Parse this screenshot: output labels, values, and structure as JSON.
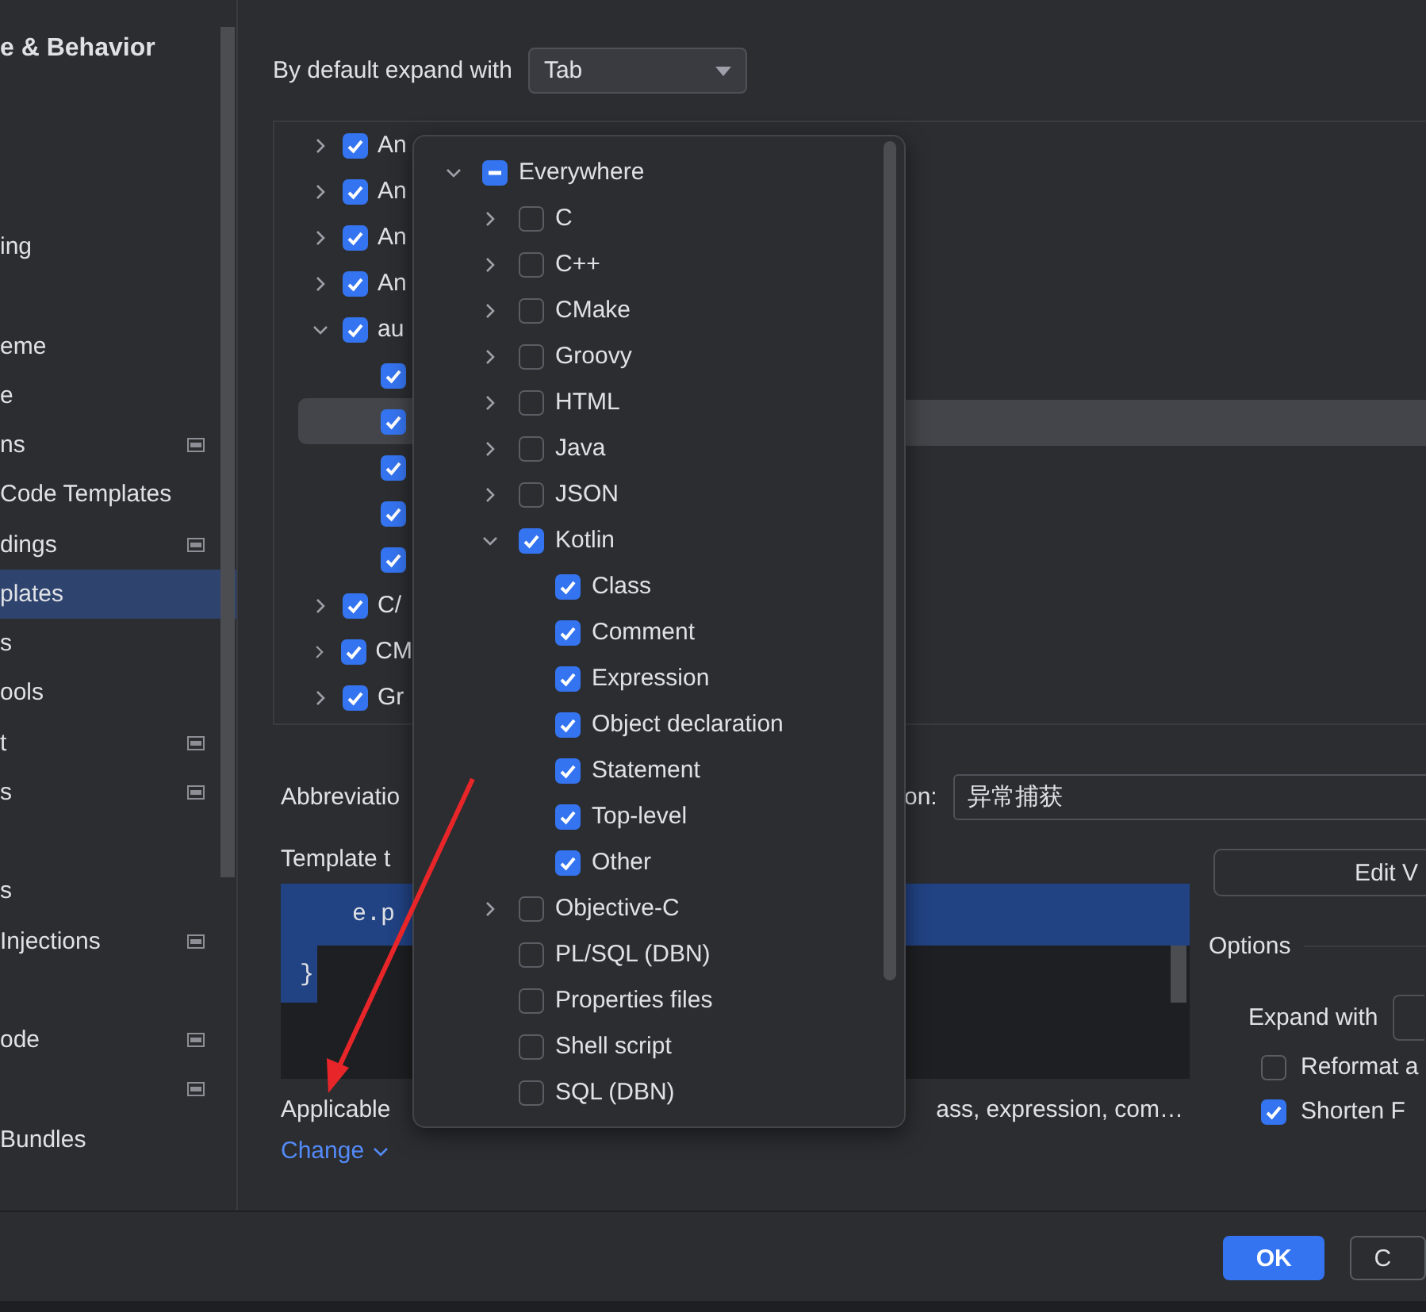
{
  "sidebar": {
    "items": [
      {
        "kind": "header",
        "text": "e & Behavior"
      },
      {
        "kind": "blank"
      },
      {
        "kind": "blank"
      },
      {
        "kind": "blank"
      },
      {
        "kind": "item",
        "text": "ing",
        "selected": false
      },
      {
        "kind": "blank"
      },
      {
        "kind": "item",
        "text": "eme",
        "selected": false
      },
      {
        "kind": "item",
        "text": "e",
        "selected": false
      },
      {
        "kind": "item",
        "text": "ns",
        "badge": true,
        "selected": false
      },
      {
        "kind": "item",
        "text": "Code Templates",
        "selected": false
      },
      {
        "kind": "item",
        "text": "dings",
        "badge": true,
        "selected": false
      },
      {
        "kind": "item",
        "text": "plates",
        "selected": true
      },
      {
        "kind": "item",
        "text": "s",
        "selected": false
      },
      {
        "kind": "item",
        "text": "ools",
        "selected": false
      },
      {
        "kind": "item",
        "text": "t",
        "badge": true,
        "selected": false
      },
      {
        "kind": "item",
        "text": "s",
        "badge": true,
        "selected": false
      },
      {
        "kind": "blank"
      },
      {
        "kind": "item",
        "text": "s",
        "selected": false
      },
      {
        "kind": "item",
        "text": " Injections",
        "badge": true,
        "selected": false
      },
      {
        "kind": "blank"
      },
      {
        "kind": "item",
        "text": "ode",
        "badge": true,
        "selected": false
      },
      {
        "kind": "item",
        "badge": true,
        "selected": false
      },
      {
        "kind": "item",
        "text": " Bundles",
        "selected": false
      }
    ]
  },
  "expand_default": {
    "label": "By default expand with",
    "value": "Tab"
  },
  "template_tree": [
    {
      "text": "An",
      "checked": true,
      "expanded": false,
      "selected": false
    },
    {
      "text": "An",
      "checked": true,
      "expanded": false,
      "selected": false
    },
    {
      "text": "An",
      "checked": true,
      "expanded": false,
      "selected": false
    },
    {
      "text": "An",
      "checked": true,
      "expanded": false,
      "selected": false
    },
    {
      "text": "au",
      "checked": true,
      "expanded": true,
      "selected": false,
      "children": [
        {
          "checked": true,
          "selected": false
        },
        {
          "checked": true,
          "selected": true
        },
        {
          "checked": true,
          "selected": false
        },
        {
          "checked": true,
          "selected": false
        },
        {
          "checked": true,
          "selected": false
        }
      ]
    },
    {
      "text": "C/",
      "checked": true,
      "expanded": false,
      "selected": false
    },
    {
      "text": "CM",
      "checked": true,
      "expanded": false,
      "selected": false
    },
    {
      "text": "Gr",
      "checked": true,
      "expanded": false,
      "selected": false
    }
  ],
  "context_popup": [
    {
      "text": "Everywhere",
      "checked": false,
      "mixed": true,
      "expanded": true,
      "children": [
        {
          "text": "C",
          "checked": false,
          "expanded": false
        },
        {
          "text": "C++",
          "checked": false,
          "expanded": false
        },
        {
          "text": "CMake",
          "checked": false,
          "expanded": false
        },
        {
          "text": "Groovy",
          "checked": false,
          "expanded": false
        },
        {
          "text": "HTML",
          "checked": false,
          "expanded": false
        },
        {
          "text": "Java",
          "checked": false,
          "expanded": false
        },
        {
          "text": "JSON",
          "checked": false,
          "expanded": false
        },
        {
          "text": "Kotlin",
          "checked": true,
          "expanded": true,
          "children": [
            {
              "text": "Class",
              "checked": true
            },
            {
              "text": "Comment",
              "checked": true
            },
            {
              "text": "Expression",
              "checked": true
            },
            {
              "text": "Object declaration",
              "checked": true
            },
            {
              "text": "Statement",
              "checked": true
            },
            {
              "text": "Top-level",
              "checked": true
            },
            {
              "text": "Other",
              "checked": true
            }
          ]
        },
        {
          "text": "Objective-C",
          "checked": false,
          "expanded": false
        },
        {
          "text": "PL/SQL (DBN)",
          "checked": false
        },
        {
          "text": "Properties files",
          "checked": false
        },
        {
          "text": "Shell script",
          "checked": false
        },
        {
          "text": "SQL (DBN)",
          "checked": false
        }
      ]
    }
  ],
  "abbreviation": {
    "label": "Abbreviatio",
    "description_label": "on:",
    "description": "异常捕获"
  },
  "template_text": {
    "label": "Template t",
    "lines": [
      "e.p",
      "}"
    ]
  },
  "applicable": {
    "label": "Applicable",
    "contexts": "ass, expression, com…",
    "link": "Change"
  },
  "edit_button": "Edit V",
  "options": {
    "title": "Options",
    "expand_label": "Expand with",
    "checkboxes": [
      {
        "label": "Reformat a",
        "checked": false
      },
      {
        "label": "Shorten F",
        "checked": true
      }
    ]
  },
  "footer": {
    "ok": "OK",
    "cancel": "C"
  }
}
